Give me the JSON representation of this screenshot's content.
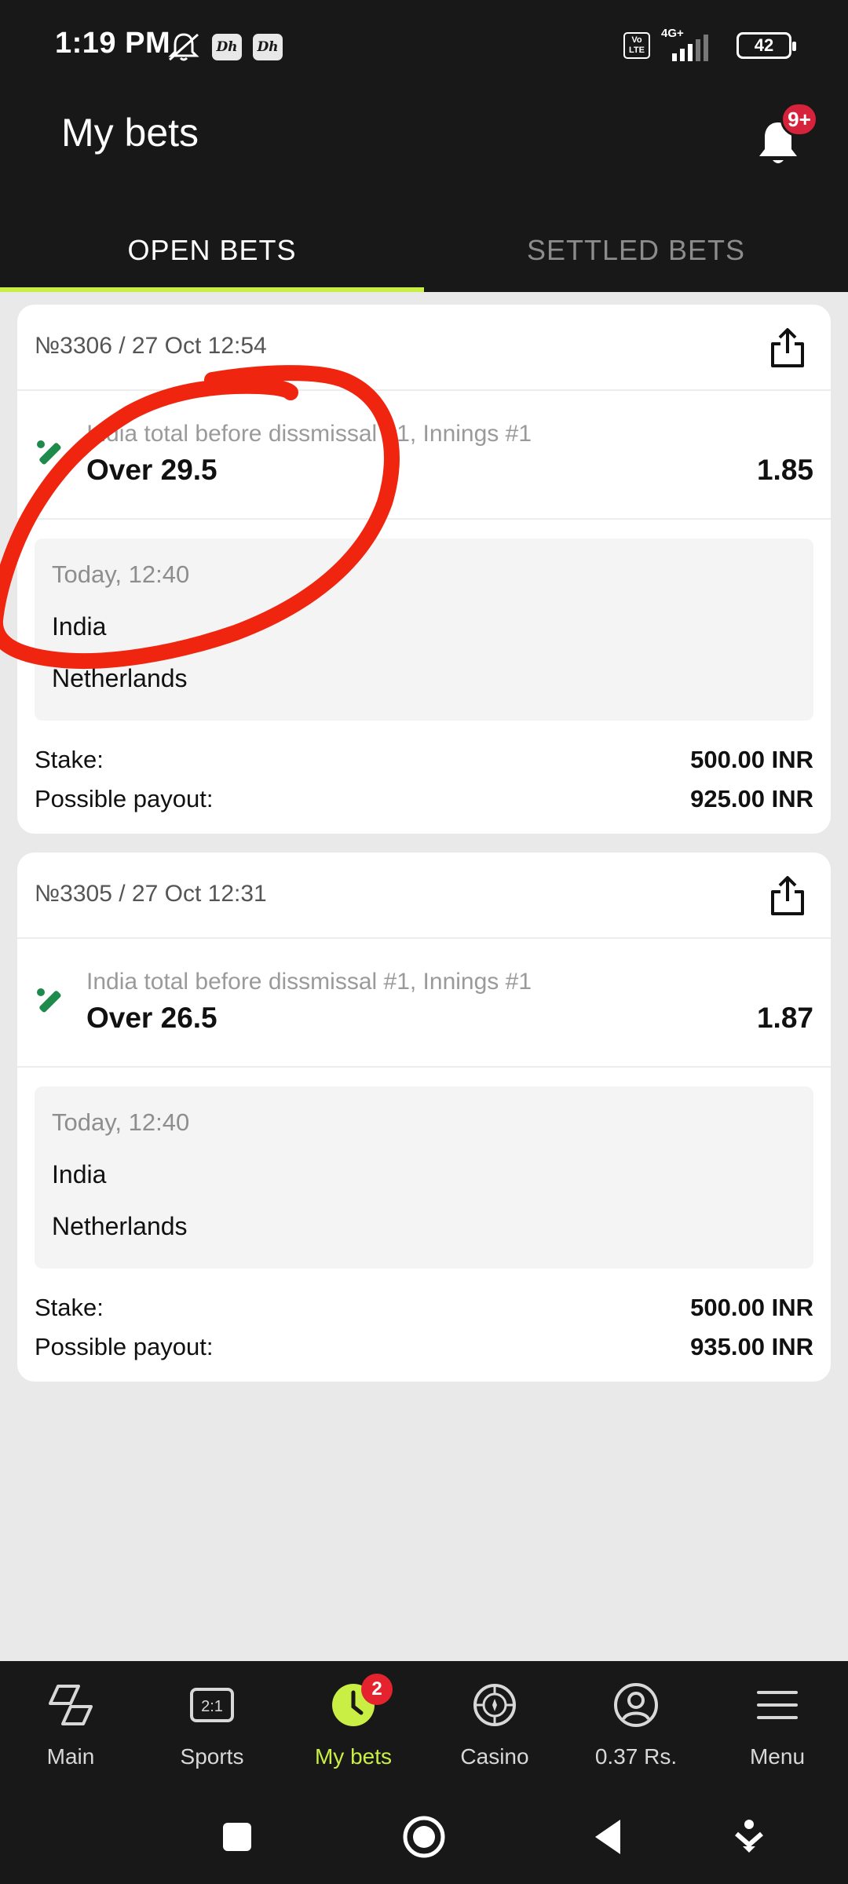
{
  "status_bar": {
    "time": "1:19 PM",
    "app_icon_label": "Dh",
    "volte": "Vo LTE",
    "network": "4G+",
    "battery": "42"
  },
  "header": {
    "title": "My bets",
    "notification_badge": "9+"
  },
  "tabs": [
    {
      "label": "OPEN BETS",
      "active": true
    },
    {
      "label": "SETTLED BETS",
      "active": false
    }
  ],
  "bets": [
    {
      "id": "№3306 / 27 Oct 12:54",
      "market": "India total before dissmissal #1,  Innings #1",
      "outcome": "Over 29.5",
      "odds": "1.85",
      "event_time": "Today, 12:40",
      "team1": "India",
      "team2": "Netherlands",
      "stake_label": "Stake:",
      "stake": "500.00 INR",
      "payout_label": "Possible payout:",
      "payout": "925.00 INR"
    },
    {
      "id": "№3305 / 27 Oct 12:31",
      "market": "India total before dissmissal #1,  Innings #1",
      "outcome": "Over 26.5",
      "odds": "1.87",
      "event_time": "Today, 12:40",
      "team1": "India",
      "team2": "Netherlands",
      "stake_label": "Stake:",
      "stake": "500.00 INR",
      "payout_label": "Possible payout:",
      "payout": "935.00 INR"
    }
  ],
  "bottom_nav": [
    {
      "label": "Main",
      "icon": "main-icon"
    },
    {
      "label": "Sports",
      "icon": "sports-icon",
      "icon_text": "2:1"
    },
    {
      "label": "My bets",
      "icon": "my-bets-icon",
      "badge": "2",
      "active": true
    },
    {
      "label": "Casino",
      "icon": "casino-icon"
    },
    {
      "label": "0.37 Rs.",
      "icon": "account-icon"
    },
    {
      "label": "Menu",
      "icon": "menu-icon"
    }
  ],
  "colors": {
    "accent": "#c9ef44",
    "dark": "#181818",
    "badge_red": "#e4232f",
    "sport_green": "#1e8a4c",
    "annotation_red": "#f0250f"
  }
}
